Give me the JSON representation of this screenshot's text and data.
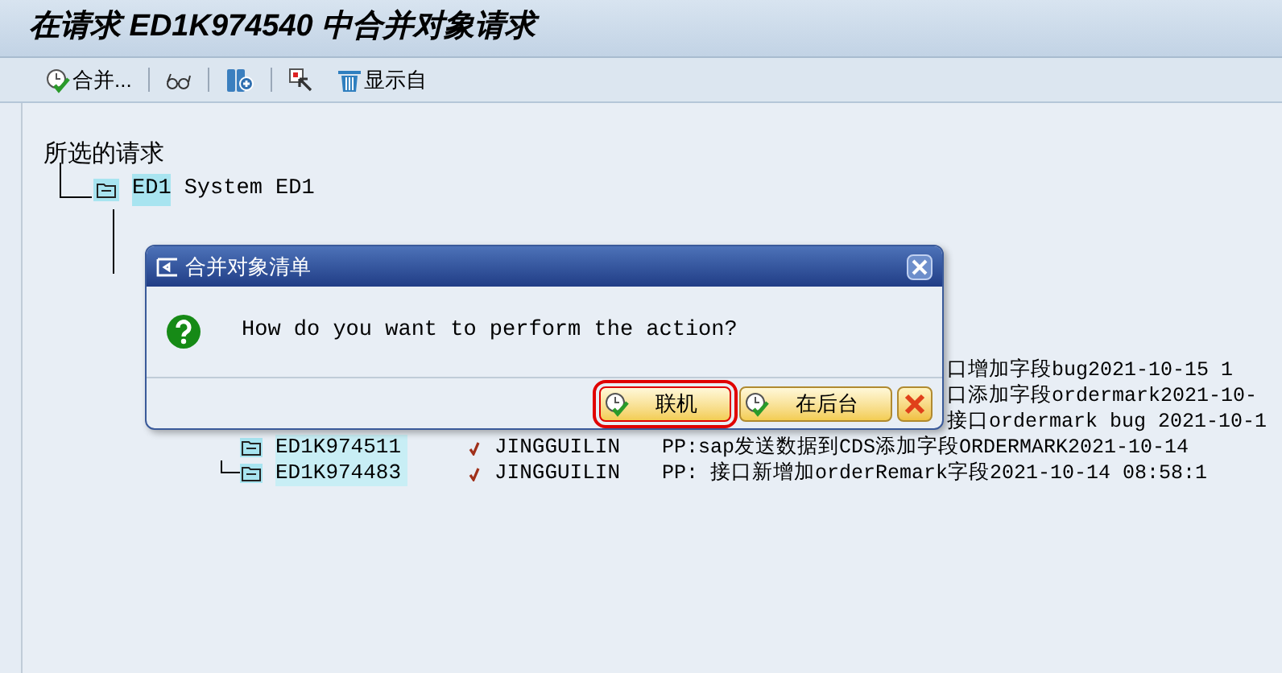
{
  "window": {
    "title": "在请求 ED1K974540 中合并对象请求"
  },
  "toolbar_groups": [
    [
      {
        "kind": "merge",
        "label": "合并..."
      }
    ],
    [
      {
        "kind": "glasses"
      }
    ],
    [
      {
        "kind": "find"
      }
    ],
    [
      {
        "kind": "select"
      },
      {
        "kind": "trash",
        "label": "显示自"
      }
    ]
  ],
  "tree": {
    "heading": "所选的请求",
    "root": {
      "key": "ED1",
      "text": "System ED1",
      "highlighted": true
    }
  },
  "rows": [
    {
      "kind": "fragment",
      "text": "口增加字段bug2021-10-15  1"
    },
    {
      "kind": "fragment",
      "text": "口添加字段ordermark2021-10-"
    },
    {
      "kind": "fragment",
      "text": "接口ordermark bug 2021-10-1"
    },
    {
      "kind": "request",
      "id": "ED1K974511",
      "owner": "JINGGUILIN",
      "description": "PP:sap发送数据到CDS添加字段ORDERMARK2021-10-14"
    },
    {
      "kind": "request",
      "id": "ED1K974483",
      "owner": "JINGGUILIN",
      "description": "PP: 接口新增加orderRemark字段2021-10-14  08:58:1"
    }
  ],
  "dialog": {
    "title": "合并对象清单",
    "message": "How do you want to perform the action?",
    "buttons": [
      {
        "kind": "confirm",
        "label": "联机",
        "selected": true
      },
      {
        "kind": "confirm",
        "label": "在后台",
        "selected": false
      },
      {
        "kind": "cancel",
        "selected": false
      }
    ]
  }
}
